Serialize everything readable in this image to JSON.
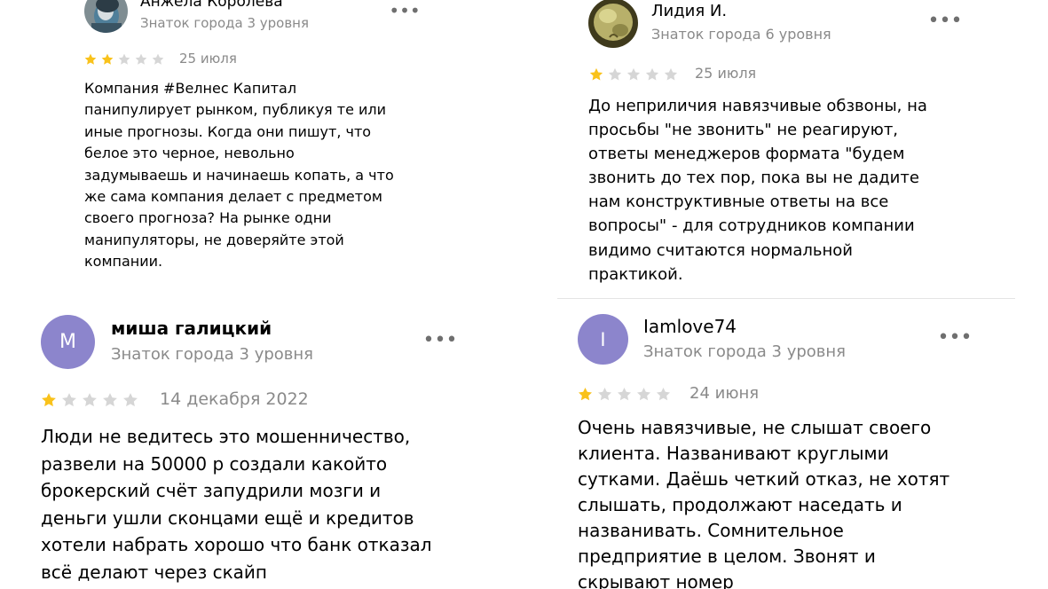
{
  "colors": {
    "star_filled": "#f9c21b",
    "star_empty": "#d6d6d6",
    "avatar_letter_bg": "#8c85cc",
    "secondary_text": "#8a8a8a",
    "divider": "#e4e4e4"
  },
  "reviews": [
    {
      "id": "c1",
      "author": "Анжела Королева",
      "level": "Знаток города 3 уровня",
      "avatar": "photo",
      "rating": 2,
      "max_rating": 5,
      "date": "25 июля",
      "more_icon": "more-horizontal-icon",
      "text": "Компания #Велнес Капитал\nпанипулирует рынком, публикуя те или\nиные прогнозы. Когда они пишут, что\nбелое это черное, невольно\nзадумываешь и начинаешь копать, а что\nже сама компания делает с предметом\nсвоего прогноза? На рынке одни\nманипуляторы, не доверяйте этой\nкомпании."
    },
    {
      "id": "c2",
      "author": "Лидия И.",
      "level": "Знаток города 6 уровня",
      "avatar": "photo",
      "rating": 1,
      "max_rating": 5,
      "date": "25 июля",
      "more_icon": "more-horizontal-icon",
      "text": "До неприличия навязчивые обзвоны, на\nпросьбы \"не звонить\" не реагируют,\nответы менеджеров формата \"будем\nзвонить до тех пор, пока вы не дадите\nнам конструктивные ответы на все\nвопросы\" - для сотрудников компании\nвидимо считаются нормальной\nпрактикой."
    },
    {
      "id": "c3",
      "author": "миша галицкий",
      "level": "Знаток города 3 уровня",
      "avatar": "letter",
      "avatar_letter": "М",
      "rating": 1,
      "max_rating": 5,
      "date": "14 декабря 2022",
      "more_icon": "more-horizontal-icon",
      "text": "Люди не ведитесь это мошенничество,\nразвели на 50000 р создали какойто\nброкерский счёт запудрили мозги и\nденьги ушли сконцами ещё и кредитов\nхотели набрать хорошо что банк отказал\nвсё делают через скайп"
    },
    {
      "id": "c4",
      "author": "Iamlove74",
      "level": "Знаток города 3 уровня",
      "avatar": "letter",
      "avatar_letter": "I",
      "rating": 1,
      "max_rating": 5,
      "date": "24 июня",
      "more_icon": "more-horizontal-icon",
      "text": "Очень навязчивые, не слышат своего\nклиента. Названивают круглыми\nсутками. Даёшь четкий отказ, не хотят\nслышать, продолжают наседать и\nназванивать. Сомнительное\nпредприятие в целом. Звонят и\nскрывают номер"
    }
  ]
}
